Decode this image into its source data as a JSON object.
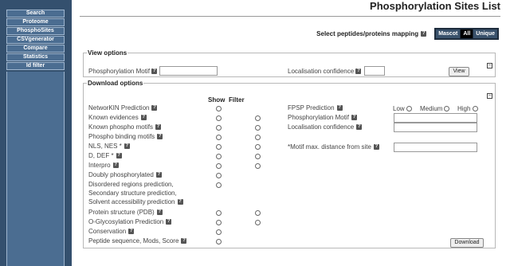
{
  "nav": {
    "items": [
      {
        "label": "Search"
      },
      {
        "label": "Proteome"
      },
      {
        "label": "PhosphoSites"
      },
      {
        "label": "CSVgenerator"
      },
      {
        "label": "Compare"
      },
      {
        "label": "Statistics"
      },
      {
        "label": "Id filter"
      }
    ]
  },
  "header": {
    "title": "Phosphorylation Sites List"
  },
  "mapping": {
    "label": "Select peptides/proteins mapping",
    "options": [
      "Mascot",
      "All",
      "Unique"
    ],
    "selected": "All"
  },
  "view_options": {
    "title": "View options",
    "motif_label": "Phosphorylation Motif",
    "motif_value": "",
    "confidence_label": "Localisation confidence",
    "confidence_value": "",
    "view_button": "View",
    "collapse": "−"
  },
  "download_options": {
    "title": "Download options",
    "collapse": "−",
    "show_header": "Show",
    "filter_header": "Filter",
    "rows": [
      {
        "label": "NetworKIN Prediction",
        "help": true
      },
      {
        "label": "Known evidences",
        "help": true
      },
      {
        "label": "Known phospho motifs",
        "help": true
      },
      {
        "label": "Phospho binding motifs",
        "help": true
      },
      {
        "label": "NLS, NES *",
        "help": true
      },
      {
        "label": "D, DEF *",
        "help": true
      },
      {
        "label": "Interpro",
        "help": true
      },
      {
        "label": "Doubly phosphorylated",
        "help": true
      },
      {
        "label": "Disordered regions prediction,",
        "help": false
      },
      {
        "label": "Secondary structure prediction,",
        "help": false
      },
      {
        "label": "Solvent accessibility prediction",
        "help": true
      },
      {
        "label": "Protein structure (PDB)",
        "help": true
      },
      {
        "label": "O-Glycosylation Prediction",
        "help": true
      },
      {
        "label": "Conservation",
        "help": true
      },
      {
        "label": "Peptide sequence, Mods, Score",
        "help": true
      }
    ],
    "fpsp_label": "FPSP Prediction",
    "fpsp_levels": [
      "Low",
      "Medium",
      "High"
    ],
    "motif_label": "Phosphorylation Motif",
    "confidence_label": "Localisation confidence",
    "distance_label": "*Motif max. distance from site",
    "download_button": "Download"
  },
  "icons": {
    "help": "?",
    "help_icon_name": "help-icon"
  }
}
